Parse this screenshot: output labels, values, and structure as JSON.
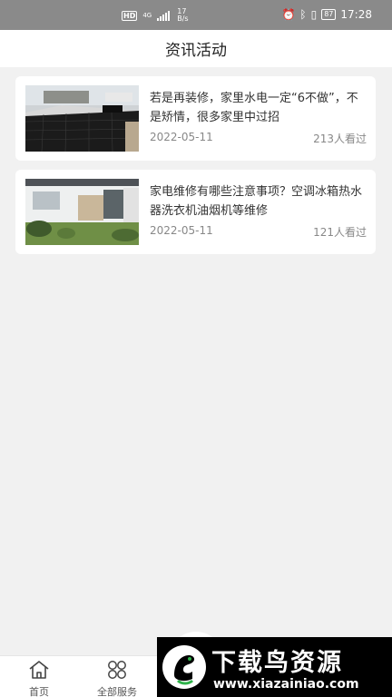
{
  "status_bar": {
    "network_type": "HD",
    "signal_label": "4G",
    "speed_value": "17",
    "speed_unit": "B/s",
    "battery": "87",
    "time": "17:28"
  },
  "header": {
    "title": "资讯活动"
  },
  "articles": [
    {
      "title": "若是再装修，家里水电一定“6不做”，不是矫情，很多家里中过招",
      "date": "2022-05-11",
      "views": "213人看过",
      "thumb_icon": "construction-photo"
    },
    {
      "title": "家电维修有哪些注意事项？空调冰箱热水器洗衣机油烟机等维修",
      "date": "2022-05-11",
      "views": "121人看过",
      "thumb_icon": "house-photo"
    }
  ],
  "bottom_nav": {
    "items": [
      {
        "label": "首页",
        "icon": "home-icon"
      },
      {
        "label": "全部服务",
        "icon": "services-grid-icon"
      }
    ]
  },
  "watermark": {
    "title": "下载鸟资源",
    "url": "www.xiazainiao.com"
  },
  "colors": {
    "status_bar": "#8a8a8a",
    "background": "#f1f1f1",
    "card": "#ffffff"
  }
}
